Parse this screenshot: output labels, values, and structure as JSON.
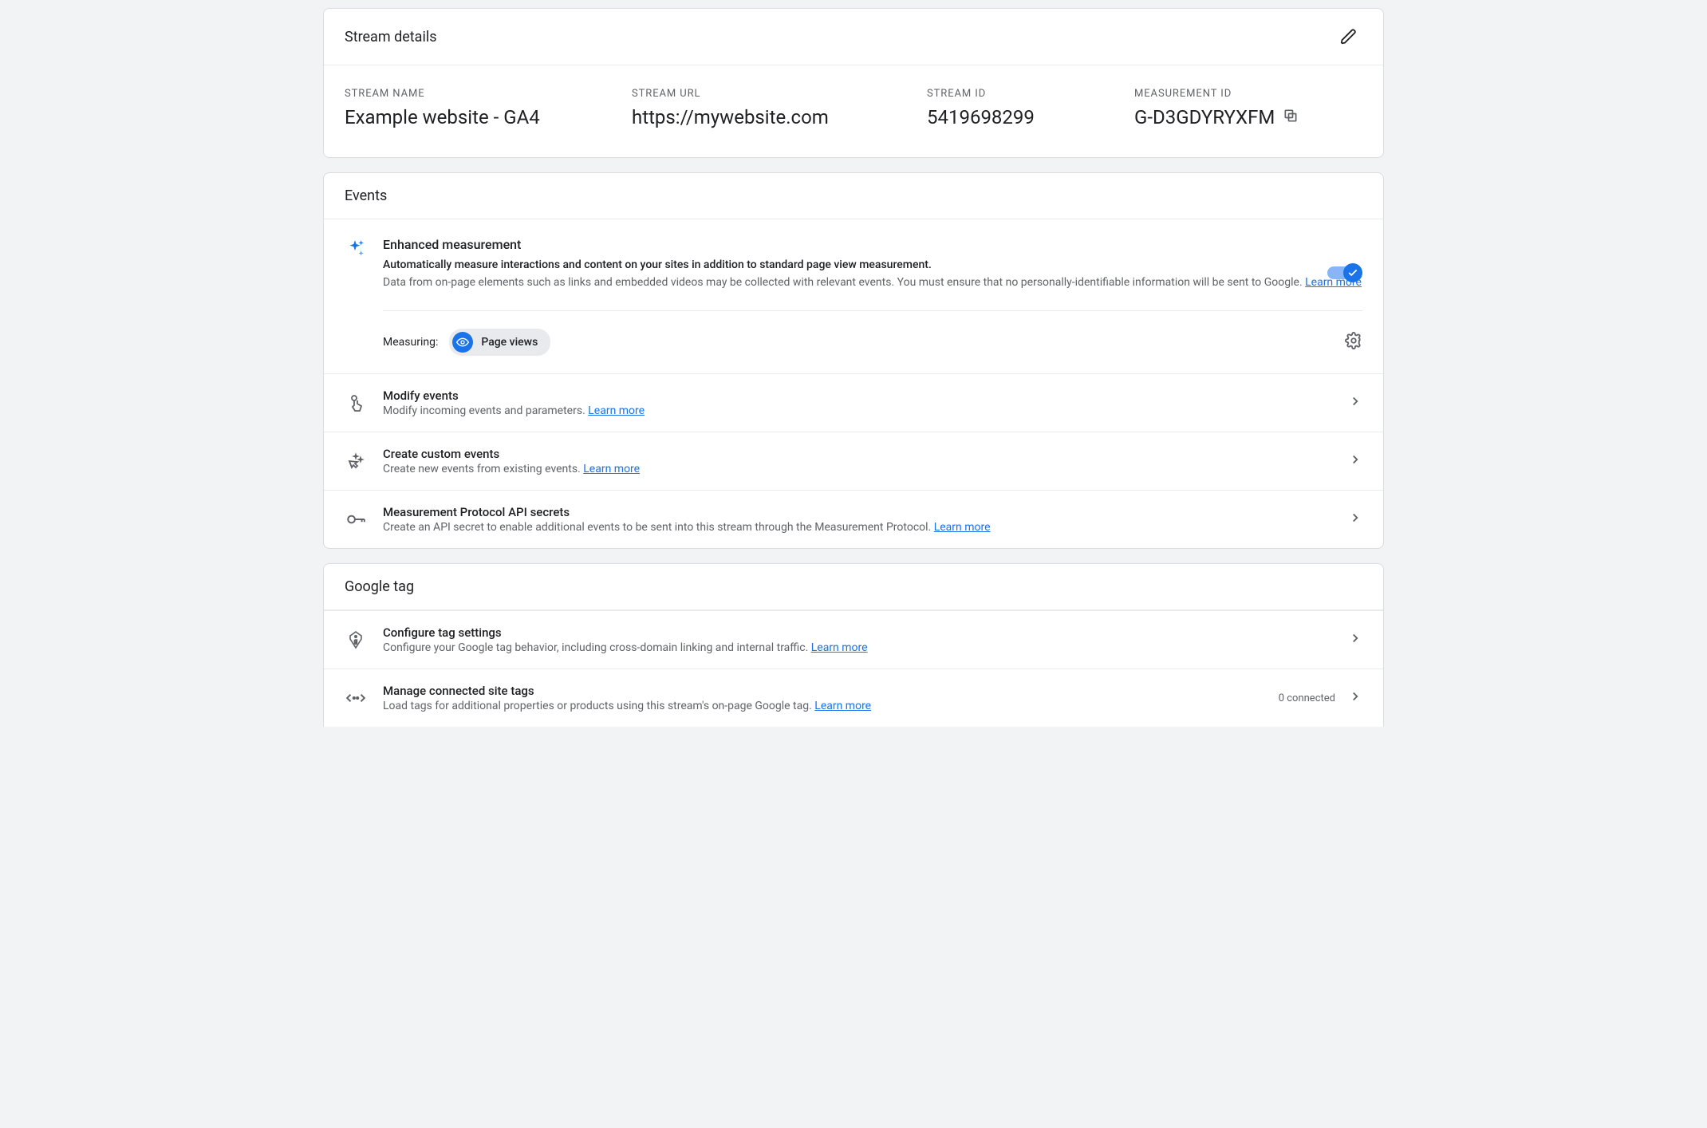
{
  "streamDetails": {
    "header": "Stream details",
    "fields": {
      "name": {
        "label": "STREAM NAME",
        "value": "Example website - GA4"
      },
      "url": {
        "label": "STREAM URL",
        "value": "https://mywebsite.com"
      },
      "id": {
        "label": "STREAM ID",
        "value": "5419698299"
      },
      "measurement": {
        "label": "MEASUREMENT ID",
        "value": "G-D3GDYRYXFM"
      }
    }
  },
  "events": {
    "header": "Events",
    "enhanced": {
      "title": "Enhanced measurement",
      "lead": "Automatically measure interactions and content on your sites in addition to standard page view measurement.",
      "sub": "Data from on-page elements such as links and embedded videos may be collected with relevant events. You must ensure that no personally-identifiable information will be sent to Google. ",
      "learnMore": "Learn more",
      "enabled": true,
      "measuringLabel": "Measuring:",
      "pill": "Page views"
    },
    "rows": [
      {
        "icon": "touch",
        "title": "Modify events",
        "sub": "Modify incoming events and parameters. ",
        "learnMore": "Learn more"
      },
      {
        "icon": "sparkle-cursor",
        "title": "Create custom events",
        "sub": "Create new events from existing events. ",
        "learnMore": "Learn more"
      },
      {
        "icon": "key",
        "title": "Measurement Protocol API secrets",
        "sub": "Create an API secret to enable additional events to be sent into this stream through the Measurement Protocol. ",
        "learnMore": "Learn more"
      }
    ]
  },
  "googleTag": {
    "header": "Google tag",
    "rows": [
      {
        "icon": "tag-g",
        "title": "Configure tag settings",
        "sub": "Configure your Google tag behavior, including cross-domain linking and internal traffic. ",
        "learnMore": "Learn more"
      },
      {
        "icon": "connect",
        "title": "Manage connected site tags",
        "sub": "Load tags for additional properties or products using this stream's on-page Google tag. ",
        "learnMore": "Learn more",
        "badge": "0 connected"
      }
    ]
  }
}
